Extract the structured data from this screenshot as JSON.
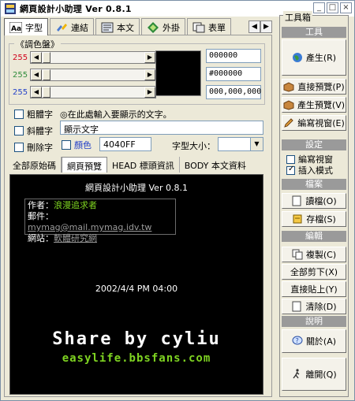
{
  "window": {
    "title": "網頁設計小助理 Ver 0.8.1",
    "buttons": {
      "minimize": "_",
      "maximize": "□",
      "close": "×"
    }
  },
  "tabs": [
    {
      "label": "字型"
    },
    {
      "label": "連結"
    },
    {
      "label": "本文"
    },
    {
      "label": "外掛"
    },
    {
      "label": "表單"
    }
  ],
  "tab_scroll": {
    "left": "◀",
    "right": "▶"
  },
  "color_panel": {
    "title": "《調色盤》",
    "rows": [
      {
        "label": "255",
        "value": "000000"
      },
      {
        "label": "255",
        "value": "#000000"
      },
      {
        "label": "255",
        "value": "000,000,000"
      }
    ]
  },
  "style_options": {
    "bold": "粗體字",
    "italic": "斜體字",
    "strike": "刪除字",
    "text_hint": "◎在此處輸入要顯示的文字。",
    "text_value": "顯示文字",
    "color_label": "顏色",
    "color_value": "4040FF",
    "size_label": "字型大小："
  },
  "subtabs": [
    {
      "label": "全部原始碼"
    },
    {
      "label": "網頁預覽"
    },
    {
      "label": "HEAD 標頭資訊"
    },
    {
      "label": "BODY 本文資料"
    }
  ],
  "preview": {
    "title": "網頁設計小助理 Ver 0.8.1",
    "author_label": "作者：",
    "author_value": "浪漫追求者",
    "email_label": "郵件：",
    "email_value": "mymag@mail.mymag.idv.tw",
    "site_label": "網站：",
    "site_value": "軟體研究網",
    "date": "2002/4/4 PM 04:00",
    "logo_line1": "Share by cyliu",
    "logo_line2": "easylife.bbsfans.com"
  },
  "toolbox": {
    "title": "工具箱",
    "sec_tools": "工具",
    "btn_generate": "產生(R)",
    "btn_direct_preview": "直接預覽(P)",
    "btn_generate_preview": "產生預覽(V)",
    "btn_edit_window": "編寫視窗(E)",
    "sec_settings": "設定",
    "chk_edit_window": "編寫視窗",
    "chk_insert_mode": "插入模式",
    "sec_file": "檔案",
    "btn_read": "讀檔(O)",
    "btn_save": "存檔(S)",
    "sec_edit": "編輯",
    "btn_copy": "複製(C)",
    "btn_cut_all": "全部剪下(X)",
    "btn_paste": "直接貼上(Y)",
    "btn_clear": "清除(D)",
    "sec_help": "說明",
    "btn_about": "關於(A)",
    "btn_exit": "離開(Q)"
  }
}
